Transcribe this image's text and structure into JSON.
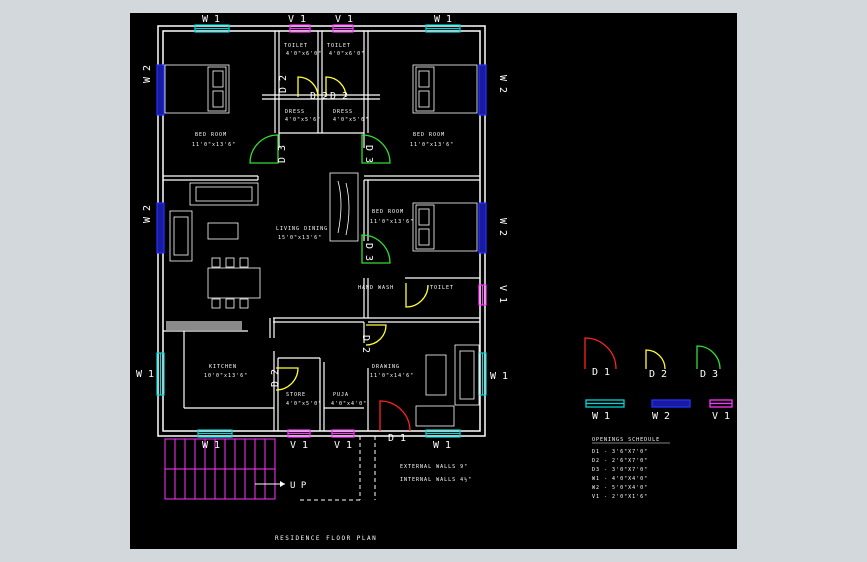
{
  "plan_title": "RESIDENCE FLOOR PLAN",
  "colors": {
    "background": "#000000",
    "viewport_border": "#d3d8dc",
    "wall": "#ffffff",
    "window_w1": "#00d6d6",
    "window_w2": "#2233ff",
    "ventilator_v1": "#ff33ff",
    "door_d1": "#ff2222",
    "door_d2": "#ffff33",
    "door_d3": "#33dd33",
    "stairs": "#ff33ff"
  },
  "marks": {
    "w1": "W 1",
    "w2": "W 2",
    "v1": "V 1",
    "d1": "D 1",
    "d2": "D 2",
    "d3": "D 3",
    "up": "U P"
  },
  "rooms": {
    "toilet": "TOILET",
    "toilet_size": "4'0\"x6'0\"",
    "dress": "DRESS",
    "dress_size": "4'0\"x5'6\"",
    "bedroom": "BED ROOM",
    "bedroom_size": "11'0\"x13'6\"",
    "living_dining": "LIVING DINING",
    "living_dining_size": "15'0\"x13'6\"",
    "hand_wash": "HAND WASH",
    "kitchen": "KITCHEN",
    "kitchen_size": "10'0\"x13'6\"",
    "store": "STORE",
    "store_size": "4'0\"x5'0\"",
    "puja": "PUJA",
    "puja_size": "4'0\"x4'0\"",
    "drawing": "DRAWING",
    "drawing_size": "11'0\"x14'6\""
  },
  "notes": {
    "external_walls": "EXTERNAL WALLS 9\"",
    "internal_walls": "INTERNAL WALLS 4½\""
  },
  "legend": {
    "title": "OPENINGS SCHEDULE",
    "rows": [
      "D1 - 3'6\"X7'0\"",
      "D2 - 2'6\"X7'0\"",
      "D3 - 3'0\"X7'0\"",
      "W1 - 4'0\"X4'0\"",
      "W2 - 5'0\"X4'0\"",
      "V1 - 2'0\"X1'6\""
    ]
  }
}
